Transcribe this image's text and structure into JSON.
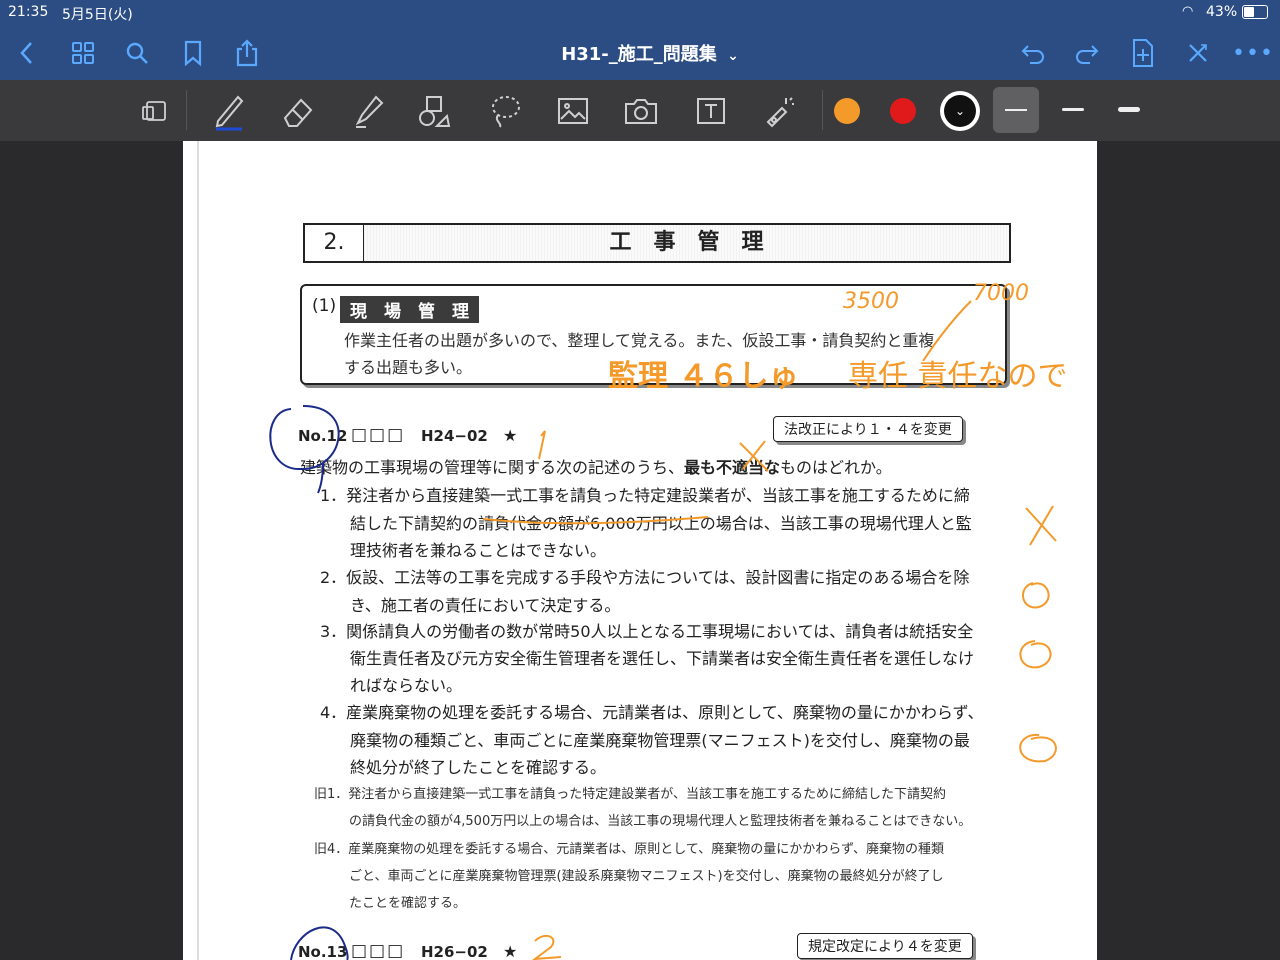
{
  "status_bar": {
    "time": "21:35",
    "date": "5月5日(火)",
    "battery": "43%"
  },
  "nav": {
    "title": "H31-_施工_問題集",
    "title_chevron": "⌄"
  },
  "colors": {
    "nav_bg": "#2c4d83",
    "accent": "#5aa9ff",
    "toolbar_bg": "#3a3a3c",
    "pen_orange": "#f39a2b",
    "pen_red": "#e01a1a",
    "ink_blue": "#1b2b8a"
  },
  "toolbar": {
    "tools": [
      "page-icon",
      "pen-icon",
      "eraser-icon",
      "highlighter-icon",
      "shapes-icon",
      "lasso-icon",
      "image-icon",
      "camera-icon",
      "text-icon",
      "laser-icon"
    ],
    "color_swatches": [
      "#f39a2b",
      "#e01a1a",
      "#111111"
    ],
    "stroke_sizes": [
      "thin",
      "medium",
      "thick"
    ]
  },
  "document": {
    "section_number": "2.",
    "section_title": "工　事　管　理",
    "subsection_label": "(1)",
    "subsection_title": "現　場　管　理",
    "intro_line1": "作業主任者の出題が多いので、整理して覚える。また、仮設工事・請負契約と重複",
    "intro_line2": "する出題も多い。",
    "q12": {
      "no": "No.12",
      "boxes": "□□□",
      "code": "H24−02",
      "star": "★",
      "note": "法改正により１・４を変更",
      "stem_pre": "建築物の工事現場の管理等に関する次の記述のうち、",
      "stem_bold": "最も不適当な",
      "stem_post": "ものはどれか。",
      "items": [
        [
          "1．発注者から直接建築一式工事を請負った特定建設業者が、当該工事を施工するために締",
          "結した下請契約の請負代金の額が6,000万円以上の場合は、当該工事の現場代理人と監",
          "理技術者を兼ねることはできない。"
        ],
        [
          "2．仮設、工法等の工事を完成する手段や方法については、設計図書に指定のある場合を除",
          "き、施工者の責任において決定する。"
        ],
        [
          "3．関係請負人の労働者の数が常時50人以上となる工事現場においては、請負者は統括安全",
          "衛生責任者及び元方安全衛生管理者を選任し、下請業者は安全衛生責任者を選任しなけ",
          "ればならない。"
        ],
        [
          "4．産業廃棄物の処理を委託する場合、元請業者は、原則として、廃棄物の量にかかわらず、",
          "廃棄物の種類ごと、車両ごとに産業廃棄物管理票(マニフェスト)を交付し、廃棄物の最",
          "終処分が終了したことを確認する。"
        ]
      ],
      "old1": [
        "旧1．発注者から直接建築一式工事を請負った特定建設業者が、当該工事を施工するために締結した下請契約",
        "の請負代金の額が4,500万円以上の場合は、当該工事の現場代理人と監理技術者を兼ねることはできない。"
      ],
      "old4": [
        "旧4．産業廃棄物の処理を委託する場合、元請業者は、原則として、廃棄物の量にかかわらず、廃棄物の種類",
        "ごと、車両ごとに産業廃棄物管理票(建設系廃棄物マニフェスト)を交付し、廃棄物の最終処分が終了し",
        "たことを確認する。"
      ]
    },
    "q13": {
      "no": "No.13",
      "boxes": "□□□",
      "code": "H26−02",
      "star": "★",
      "note": "規定改定により４を変更"
    }
  },
  "handwriting": {
    "n3500": "3500",
    "n7000": "7000",
    "kanri": "監理 ４６しゅ",
    "junin": "専任 責任なので",
    "q12_answer": "1",
    "q13_answer": "2",
    "marks": [
      "X",
      "O",
      "O",
      "O"
    ]
  }
}
